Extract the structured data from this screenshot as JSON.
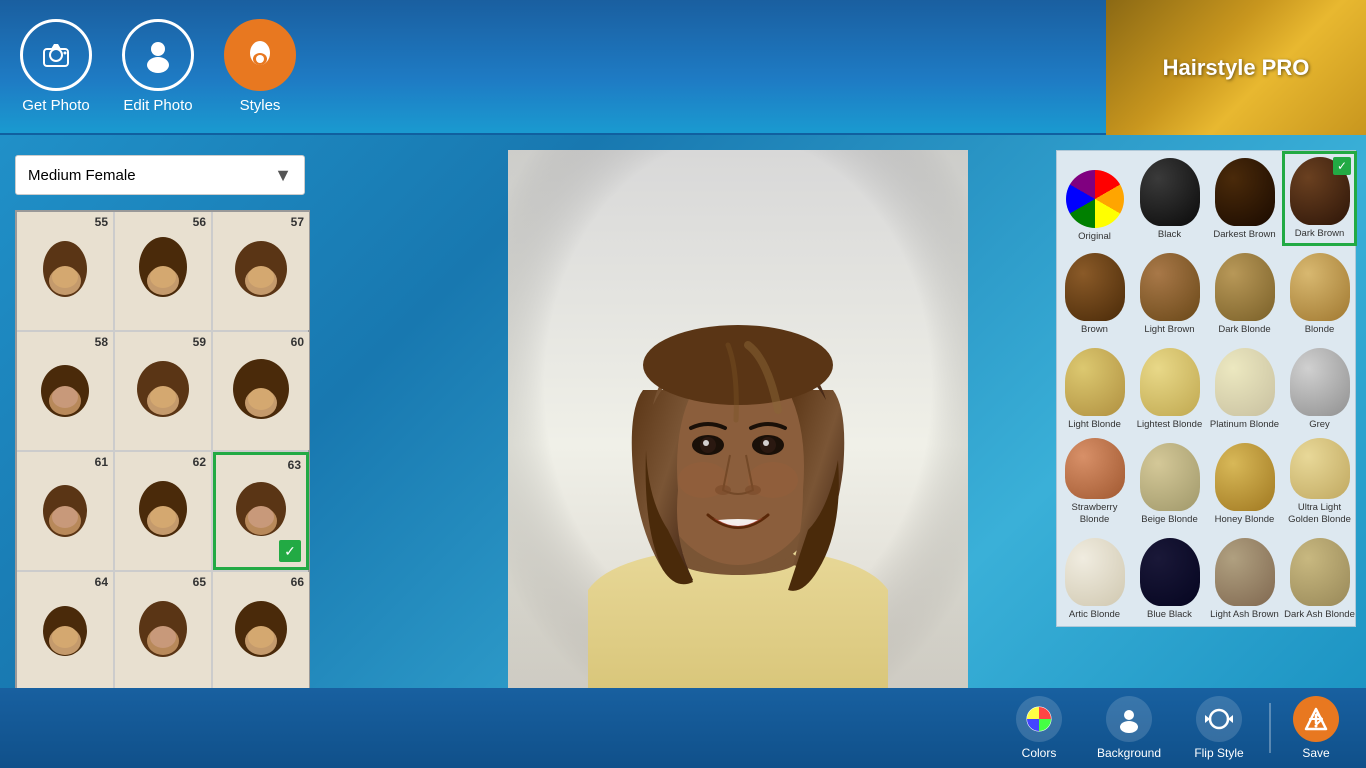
{
  "header": {
    "title": "Hairstyle PRO",
    "nav": [
      {
        "id": "get-photo",
        "label": "Get Photo",
        "icon": "📷",
        "active": false
      },
      {
        "id": "edit-photo",
        "label": "Edit Photo",
        "icon": "👤",
        "active": false
      },
      {
        "id": "styles",
        "label": "Styles",
        "icon": "💇",
        "active": true
      }
    ]
  },
  "left_panel": {
    "dropdown_label": "Medium Female",
    "styles": [
      {
        "num": 55
      },
      {
        "num": 56
      },
      {
        "num": 57
      },
      {
        "num": 58
      },
      {
        "num": 59
      },
      {
        "num": 60
      },
      {
        "num": 61
      },
      {
        "num": 62
      },
      {
        "num": 63,
        "selected": true
      },
      {
        "num": 64
      },
      {
        "num": 65
      },
      {
        "num": 66
      }
    ]
  },
  "colors": [
    {
      "id": "reset",
      "label": "Original",
      "type": "reset"
    },
    {
      "id": "black",
      "label": "Black",
      "color": "#1a1a1a"
    },
    {
      "id": "darkest-brown",
      "label": "Darkest Brown",
      "color": "#2d1a0a"
    },
    {
      "id": "dark-brown",
      "label": "Dark Brown",
      "color": "#3d2010",
      "selected": true
    },
    {
      "id": "brown",
      "label": "Brown",
      "color": "#6b3a1a"
    },
    {
      "id": "light-brown",
      "label": "Light Brown",
      "color": "#8b5a2a"
    },
    {
      "id": "dark-blonde",
      "label": "Dark Blonde",
      "color": "#9a7a3a"
    },
    {
      "id": "blonde",
      "label": "Blonde",
      "color": "#c8a050"
    },
    {
      "id": "light-blonde",
      "label": "Light Blonde",
      "color": "#d4b060"
    },
    {
      "id": "lightest-blonde",
      "label": "Lightest Blonde",
      "color": "#e0c880"
    },
    {
      "id": "platinum-blonde",
      "label": "Platinum Blonde",
      "color": "#e8d8a0"
    },
    {
      "id": "grey",
      "label": "Grey",
      "color": "#b0b0b0"
    },
    {
      "id": "strawberry-blonde",
      "label": "Strawberry Blonde",
      "color": "#c87850"
    },
    {
      "id": "beige-blonde",
      "label": "Beige Blonde",
      "color": "#c8b88a"
    },
    {
      "id": "honey-blonde",
      "label": "Honey Blonde",
      "color": "#d4a048"
    },
    {
      "id": "ultra-light-golden-blonde",
      "label": "Ultra Light Golden Blonde",
      "color": "#dcc888"
    },
    {
      "id": "artic-blonde",
      "label": "Artic Blonde",
      "color": "#e8e0c0"
    },
    {
      "id": "blue-black",
      "label": "Blue Black",
      "color": "#0a0a28"
    },
    {
      "id": "light-ash-brown",
      "label": "Light Ash Brown",
      "color": "#9a8868"
    },
    {
      "id": "dark-ash-blonde",
      "label": "Dark Ash Blonde",
      "color": "#b8a870"
    }
  ],
  "bottom_bar": {
    "tools": [
      {
        "id": "colors",
        "label": "Colors",
        "icon": "🎨"
      },
      {
        "id": "background",
        "label": "Background",
        "icon": "👤"
      },
      {
        "id": "flip-style",
        "label": "Flip Style",
        "icon": "🔄"
      }
    ],
    "save_label": "Save"
  }
}
